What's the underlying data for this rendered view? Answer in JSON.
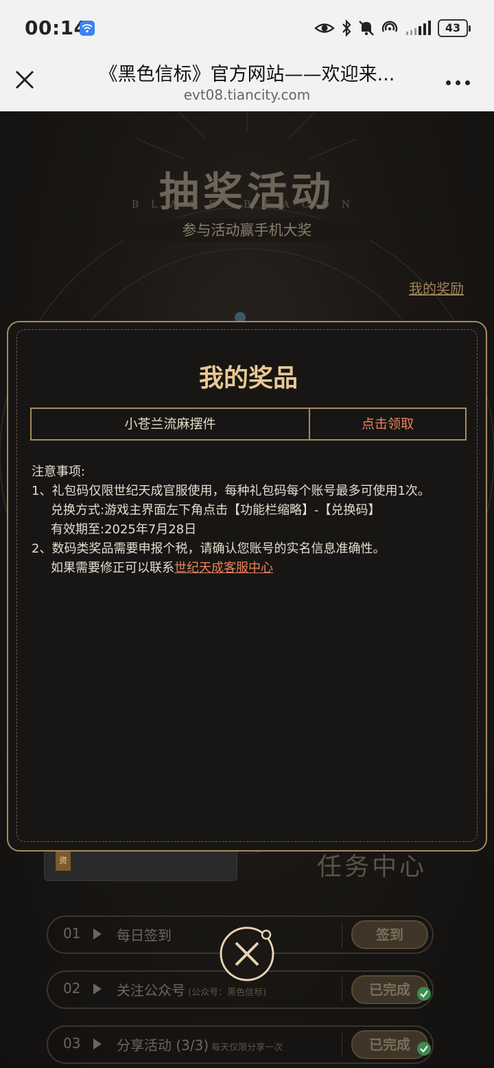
{
  "status_bar": {
    "time": "00:14",
    "battery": "43",
    "wifi_icon": "wifi-icon",
    "signal_icons": [
      "eye-icon",
      "bluetooth-icon",
      "mute-icon",
      "hotspot-icon",
      "signal-icon"
    ]
  },
  "browser": {
    "title": "《黑色信标》官方网站——欢迎来...",
    "url": "evt08.tiancity.com"
  },
  "background_page": {
    "headline": "抽奖活动",
    "headline_sub": "BLACK BEACON",
    "tagline": "参与活动赢手机大奖",
    "my_rewards_link": "我的奖励",
    "task_center_title": "任务中心",
    "prize_card_tag": "资",
    "tasks": [
      {
        "num": "01",
        "label": "每日签到",
        "note": "",
        "button": "签到",
        "done": false
      },
      {
        "num": "02",
        "label": "关注公众号",
        "note": "(公众号：黑色信标)",
        "button": "已完成",
        "done": true
      },
      {
        "num": "03",
        "label": "分享活动 (3/3)",
        "note": "每天仅限分享一次",
        "button": "已完成",
        "done": true
      }
    ]
  },
  "modal": {
    "title": "我的奖品",
    "prize_name": "小苍兰流麻摆件",
    "claim_label": "点击领取",
    "notes_title": "注意事项:",
    "note_1": "1、礼包码仅限世纪天成官服使用，每种礼包码每个账号最多可使用1次。",
    "note_1_method": "兑换方式:游戏主界面左下角点击【功能栏缩略】-【兑换码】",
    "note_1_expiry": "有效期至:2025年7月28日",
    "note_2": "2、数码类奖品需要申报个税，请确认您账号的实名信息准确性。",
    "note_2_contact_prefix": "如果需要修正可以联系",
    "note_2_contact_link": "世纪天成客服中心"
  },
  "colors": {
    "accent_gold": "#a88b60",
    "title_gold": "#e8c994",
    "link_orange": "#e8845a"
  }
}
